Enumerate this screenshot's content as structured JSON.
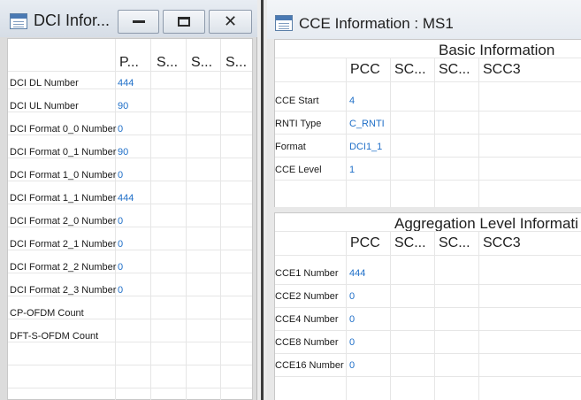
{
  "dci_window": {
    "title": "DCI Infor...",
    "columns": [
      "P...",
      "S...",
      "S...",
      "S..."
    ],
    "rows": [
      {
        "label": "DCI DL Number",
        "value": "444"
      },
      {
        "label": "DCI UL Number",
        "value": "90"
      },
      {
        "label": "DCI Format 0_0 Number",
        "value": "0"
      },
      {
        "label": "DCI Format 0_1 Number",
        "value": "90"
      },
      {
        "label": "DCI Format 1_0 Number",
        "value": "0"
      },
      {
        "label": "DCI Format 1_1 Number",
        "value": "444"
      },
      {
        "label": "DCI Format 2_0 Number",
        "value": "0"
      },
      {
        "label": "DCI Format 2_1 Number",
        "value": "0"
      },
      {
        "label": "DCI Format 2_2 Number",
        "value": "0"
      },
      {
        "label": "DCI Format 2_3 Number",
        "value": "0"
      },
      {
        "label": "CP-OFDM Count",
        "value": ""
      },
      {
        "label": "DFT-S-OFDM Count",
        "value": ""
      }
    ],
    "buttons": {
      "minimize": "minimize-icon",
      "maximize": "maximize-icon",
      "close": "✕"
    }
  },
  "cce_window": {
    "title": "CCE Information : MS1",
    "basic": {
      "title": "Basic Information",
      "columns": [
        "PCC",
        "SC...",
        "SC...",
        "SCC3"
      ],
      "rows": [
        {
          "label": "CCE Start",
          "value": "4"
        },
        {
          "label": "RNTI Type",
          "value": "C_RNTI"
        },
        {
          "label": "Format",
          "value": "DCI1_1"
        },
        {
          "label": "CCE Level",
          "value": "1"
        }
      ]
    },
    "aggregation": {
      "title": "Aggregation Level Informati",
      "columns": [
        "PCC",
        "SC...",
        "SC...",
        "SCC3"
      ],
      "rows": [
        {
          "label": "CCE1 Number",
          "value": "444"
        },
        {
          "label": "CCE2 Number",
          "value": "0"
        },
        {
          "label": "CCE4 Number",
          "value": "0"
        },
        {
          "label": "CCE8 Number",
          "value": "0"
        },
        {
          "label": "CCE16 Number",
          "value": "0"
        }
      ]
    }
  },
  "colors": {
    "value_text": "#1f6fc8",
    "divider": "#3c3c3c"
  }
}
